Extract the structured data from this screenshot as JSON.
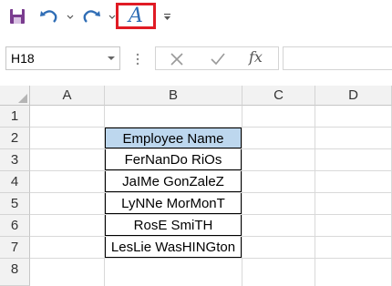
{
  "quick_access": {
    "save_icon": "save-icon",
    "undo_icon": "undo-icon",
    "redo_icon": "redo-icon",
    "custom_button_glyph": "A",
    "highlight_color": "#e01b24"
  },
  "formula_bar": {
    "name_box": "H18",
    "fx_label": "fx",
    "formula": ""
  },
  "columns": [
    "A",
    "B",
    "C",
    "D"
  ],
  "rows": [
    "1",
    "2",
    "3",
    "4",
    "5",
    "6",
    "7",
    "8"
  ],
  "table": {
    "header": "Employee Name",
    "header_fill": "#bdd7ee",
    "names": [
      "FerNanDo RiOs",
      "JaIMe GonZaleZ",
      "LyNNe MorMonT",
      "RosE SmiTH",
      "LesLie WasHINGton"
    ]
  }
}
